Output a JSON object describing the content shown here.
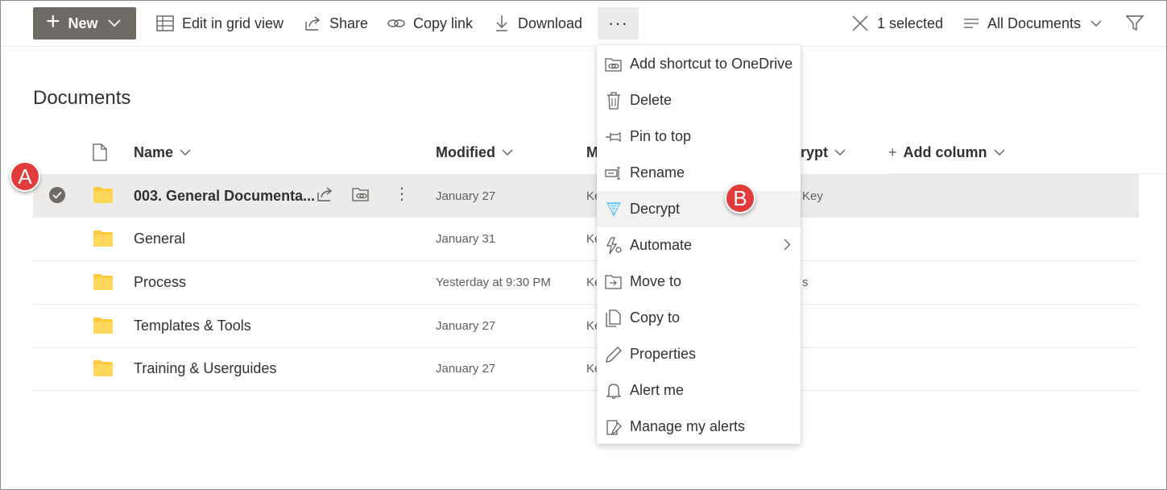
{
  "toolbar": {
    "new_label": "New",
    "edit_grid_label": "Edit in grid view",
    "share_label": "Share",
    "copy_link_label": "Copy link",
    "download_label": "Download",
    "more_label": "···",
    "selected_label": "1 selected",
    "view_label": "All Documents"
  },
  "page": {
    "title": "Documents"
  },
  "columns": {
    "name": "Name",
    "modified": "Modified",
    "modified_by_partial": "M",
    "decrypt_partial": "rypt",
    "add_column": "Add column"
  },
  "rows": [
    {
      "name": "003. General Documenta...",
      "modified": "January 27",
      "modified_by": "Ke",
      "decrypt": "Key"
    },
    {
      "name": "General",
      "modified": "January 31",
      "modified_by": "Ke",
      "decrypt": ""
    },
    {
      "name": "Process",
      "modified": "Yesterday at 9:30 PM",
      "modified_by": "Ke",
      "decrypt": "s"
    },
    {
      "name": "Templates & Tools",
      "modified": "January 27",
      "modified_by": "Ke",
      "decrypt": ""
    },
    {
      "name": "Training & Userguides",
      "modified": "January 27",
      "modified_by": "Ke",
      "decrypt": ""
    }
  ],
  "menu": {
    "items": [
      {
        "label": "Add shortcut to OneDrive",
        "icon": "shortcut-icon"
      },
      {
        "label": "Delete",
        "icon": "trash-icon"
      },
      {
        "label": "Pin to top",
        "icon": "pin-icon"
      },
      {
        "label": "Rename",
        "icon": "rename-icon"
      },
      {
        "label": "Decrypt",
        "icon": "decrypt-icon"
      },
      {
        "label": "Automate",
        "icon": "automate-icon"
      },
      {
        "label": "Move to",
        "icon": "move-icon"
      },
      {
        "label": "Copy to",
        "icon": "copy-icon"
      },
      {
        "label": "Properties",
        "icon": "pencil-icon"
      },
      {
        "label": "Alert me",
        "icon": "bell-icon"
      },
      {
        "label": "Manage my alerts",
        "icon": "manage-alerts-icon"
      }
    ]
  },
  "callouts": {
    "a": "A",
    "b": "B"
  },
  "colors": {
    "callout": "#e13b3b",
    "folder": "#ffc83d",
    "new_button": "#6e6a66"
  }
}
